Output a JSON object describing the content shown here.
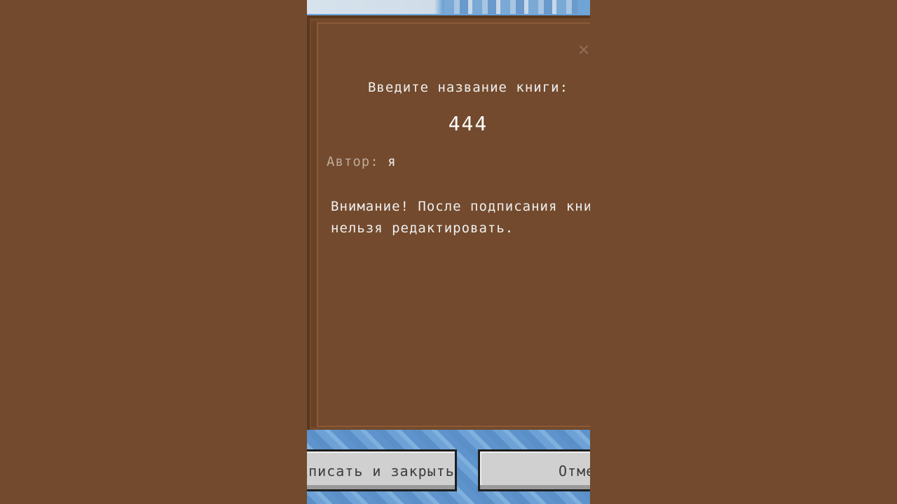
{
  "dialog": {
    "title_prompt": "Введите название книги:",
    "title_value": "444",
    "author_label": "Автор:",
    "author_value": "я",
    "warning_line1": "Внимание! После подписания книгу",
    "warning_line2": "нельзя редактировать.",
    "close_icon": "close-icon"
  },
  "buttons": {
    "sign_label": "Подписать и закрыть",
    "cancel_label": "Отмена"
  },
  "colors": {
    "panel": "#734a2d",
    "text": "#efefef",
    "label": "#bfa998",
    "button": "#d0d0d0"
  }
}
